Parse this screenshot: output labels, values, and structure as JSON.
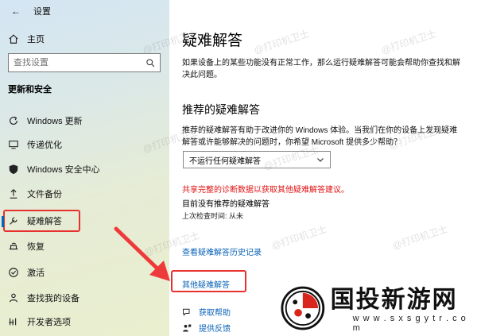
{
  "window": {
    "title": "设置"
  },
  "sidebar": {
    "home": "主页",
    "search_placeholder": "查找设置",
    "section": "更新和安全",
    "items": [
      {
        "label": "Windows 更新",
        "icon": "refresh-icon"
      },
      {
        "label": "传递优化",
        "icon": "delivery-icon"
      },
      {
        "label": "Windows 安全中心",
        "icon": "shield-icon"
      },
      {
        "label": "文件备份",
        "icon": "backup-icon"
      },
      {
        "label": "疑难解答",
        "icon": "wrench-icon",
        "active": true
      },
      {
        "label": "恢复",
        "icon": "recovery-icon"
      },
      {
        "label": "激活",
        "icon": "check-circle-icon"
      },
      {
        "label": "查找我的设备",
        "icon": "person-pin-icon"
      },
      {
        "label": "开发者选项",
        "icon": "developer-icon"
      }
    ]
  },
  "main": {
    "title": "疑难解答",
    "description": "如果设备上的某些功能没有正常工作，那么运行疑难解答可能会帮助你查找和解决此问题。",
    "recommended_title": "推荐的疑难解答",
    "recommended_desc": "推荐的疑难解答有助于改进你的 Windows 体验。当我们在你的设备上发现疑难解答或许能够解决的问题时，你希望 Microsoft 提供多少帮助？",
    "dropdown_value": "不运行任何疑难解答",
    "warning": "共享完整的诊断数据以获取其他疑难解答建议。",
    "no_recommendations": "目前没有推荐的疑难解答",
    "last_check": "上次检查时间: 从未",
    "history_link": "查看疑难解答历史记录",
    "other_link": "其他疑难解答",
    "help_link": "获取帮助",
    "feedback_link": "提供反馈"
  },
  "watermark": "@打印机卫士",
  "logo": {
    "main": "国投新游网",
    "sub": "w w w . s x s g y t r . c o m"
  },
  "colors": {
    "accent": "#0067c0",
    "link": "#0b63b7",
    "warning": "#e01010",
    "highlight": "#e6312e"
  }
}
